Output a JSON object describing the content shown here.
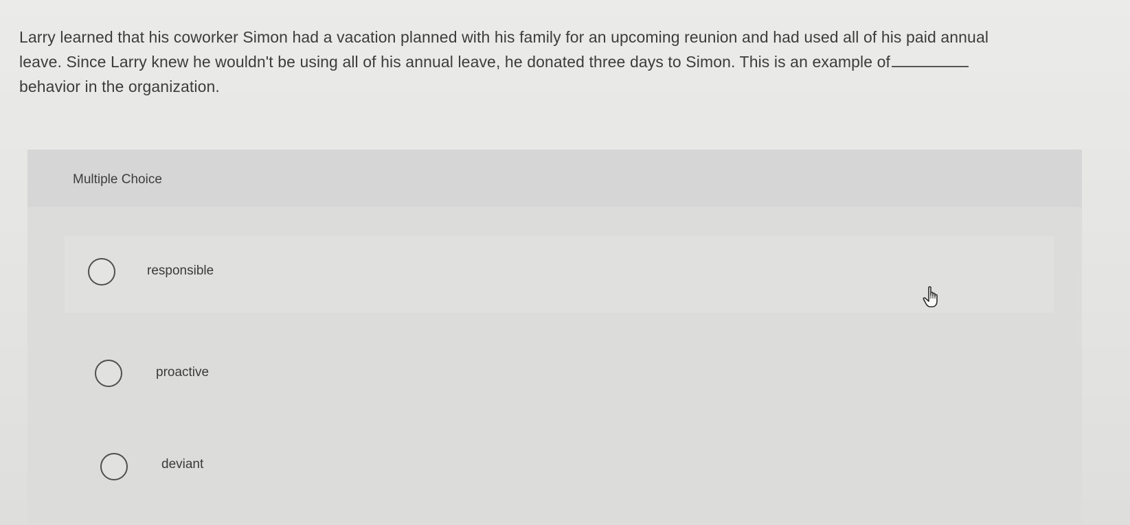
{
  "question": {
    "line1": "Larry learned that his coworker Simon had a vacation planned with his family for an upcoming reunion and had used all of his paid annual",
    "line2": "leave. Since Larry knew he wouldn't be using all of his annual leave, he donated three days to Simon. This is an example of",
    "line3": "behavior in the organization."
  },
  "choice_section": {
    "header": "Multiple Choice",
    "options": [
      {
        "label": "responsible"
      },
      {
        "label": "proactive"
      },
      {
        "label": "deviant"
      }
    ]
  },
  "icons": {
    "radio": "radio-unselected-icon",
    "pointer": "hand-pointer-icon"
  },
  "colors": {
    "background": "#e6e6e4",
    "panel": "#dcdcdb",
    "text": "#3a3a3a"
  }
}
